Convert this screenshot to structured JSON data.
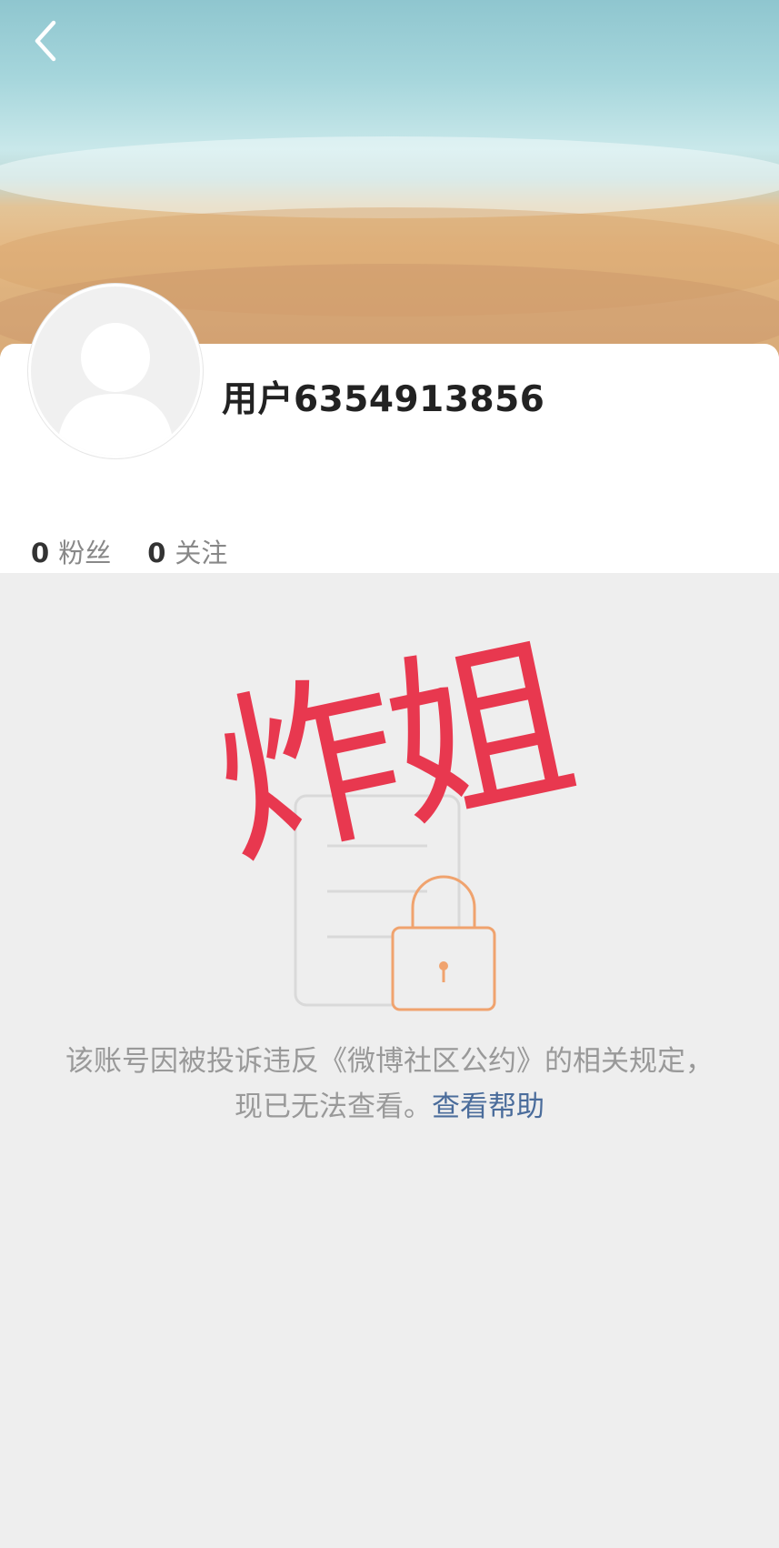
{
  "profile": {
    "username": "用户6354913856",
    "fans_count": "0",
    "fans_label": "粉丝",
    "following_count": "0",
    "following_label": "关注"
  },
  "stamp": {
    "text": "炸姐",
    "color": "#e8384f"
  },
  "notice": {
    "message": "该账号因被投诉违反《微博社区公约》的相关规定，现已无法查看。",
    "help_link": "查看帮助"
  },
  "icons": {
    "back": "back-arrow-icon",
    "lock": "lock-icon",
    "document": "document-icon"
  },
  "colors": {
    "link": "#4a6c9b",
    "lock": "#f0a36e",
    "background": "#eeeeee"
  }
}
